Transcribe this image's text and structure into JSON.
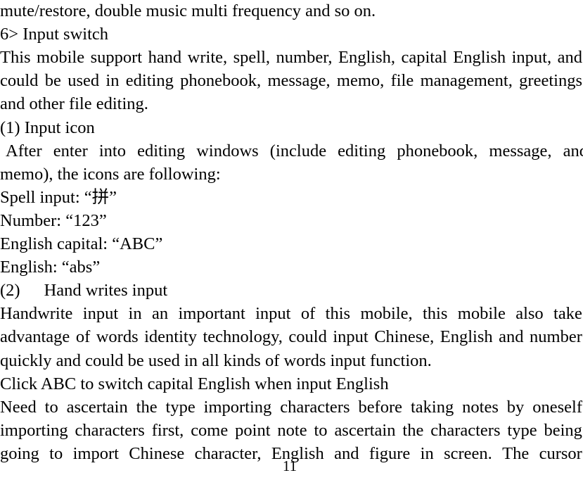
{
  "document": {
    "page_number": "11",
    "lines": [
      {
        "id": "line-1",
        "align": "flush",
        "text": "mute/restore, double music multi frequency and so on."
      },
      {
        "id": "line-2",
        "align": "flush",
        "text": "6> Input switch"
      },
      {
        "id": "line-3",
        "align": "justify",
        "text": "This mobile support hand write, spell, number, English, capital English input, and",
        "words": [
          "This",
          "mobile",
          "support",
          "hand",
          "write,",
          "spell,",
          "number,",
          "English,",
          "capital",
          "English",
          "input,",
          "and"
        ]
      },
      {
        "id": "line-4",
        "align": "justify",
        "text": "could be used in editing phonebook, message, memo, file management, greetings",
        "words": [
          "could",
          "be",
          "used",
          "in",
          "editing",
          "phonebook,",
          "message,",
          "memo,",
          "file",
          "management,",
          "greetings"
        ]
      },
      {
        "id": "line-5",
        "align": "flush",
        "text": "and other file editing."
      },
      {
        "id": "line-6",
        "align": "flush",
        "text": "(1) Input icon"
      },
      {
        "id": "line-7",
        "align": "justify",
        "indent": true,
        "text": "After enter into editing windows (include editing phonebook, message, and",
        "words": [
          "After",
          "enter",
          "into",
          "editing",
          "windows",
          "(include",
          "editing",
          "phonebook,",
          "message,",
          "and"
        ]
      },
      {
        "id": "line-8",
        "align": "flush",
        "text": "memo), the icons are following:"
      },
      {
        "id": "line-9",
        "align": "flush",
        "text": "Spell input: “拼”"
      },
      {
        "id": "line-10",
        "align": "flush",
        "text": "Number: “123”"
      },
      {
        "id": "line-11",
        "align": "flush",
        "text": "English capital: “ABC”"
      },
      {
        "id": "line-12",
        "align": "flush",
        "text": "English: “abs”"
      },
      {
        "id": "line-13",
        "align": "flush",
        "tab_after_marker": true,
        "marker": "(2)",
        "text": "Hand writes input"
      },
      {
        "id": "line-14",
        "align": "justify",
        "text": "Handwrite input in an important input of this mobile, this mobile also take",
        "words": [
          "Handwrite",
          "input",
          "in",
          "an",
          "important",
          "input",
          "of",
          "this",
          "mobile,",
          "this",
          "mobile",
          "also",
          "take"
        ]
      },
      {
        "id": "line-15",
        "align": "justify",
        "text": "advantage of words identity technology, could input Chinese, English and number",
        "words": [
          "advantage",
          "of",
          "words",
          "identity",
          "technology,",
          "could",
          "input",
          "Chinese,",
          "English",
          "and",
          "number"
        ]
      },
      {
        "id": "line-16",
        "align": "flush",
        "text": "quickly and could be used in all kinds of words input function."
      },
      {
        "id": "line-17",
        "align": "flush",
        "text": "Click ABC to switch capital English when input English"
      },
      {
        "id": "line-18",
        "align": "justify",
        "text": "Need to ascertain the type importing characters before taking notes by oneself",
        "words": [
          "Need",
          "to",
          "ascertain",
          "the",
          "type",
          "importing",
          "characters",
          "before",
          "taking",
          "notes",
          "by",
          "oneself"
        ]
      },
      {
        "id": "line-19",
        "align": "justify",
        "text": "importing characters first, come point note to ascertain the characters type being",
        "words": [
          "importing",
          "characters",
          "first,",
          "come",
          "point",
          "note",
          "to",
          "ascertain",
          "the",
          "characters",
          "type",
          "being"
        ]
      },
      {
        "id": "line-20",
        "align": "justify",
        "text": "going to import Chinese character, English and figure in screen. The cursor",
        "words": [
          "going",
          "to",
          "import",
          "Chinese",
          "character,",
          "English",
          "and",
          "figure",
          "in",
          "screen.",
          "The",
          "cursor"
        ]
      }
    ]
  }
}
